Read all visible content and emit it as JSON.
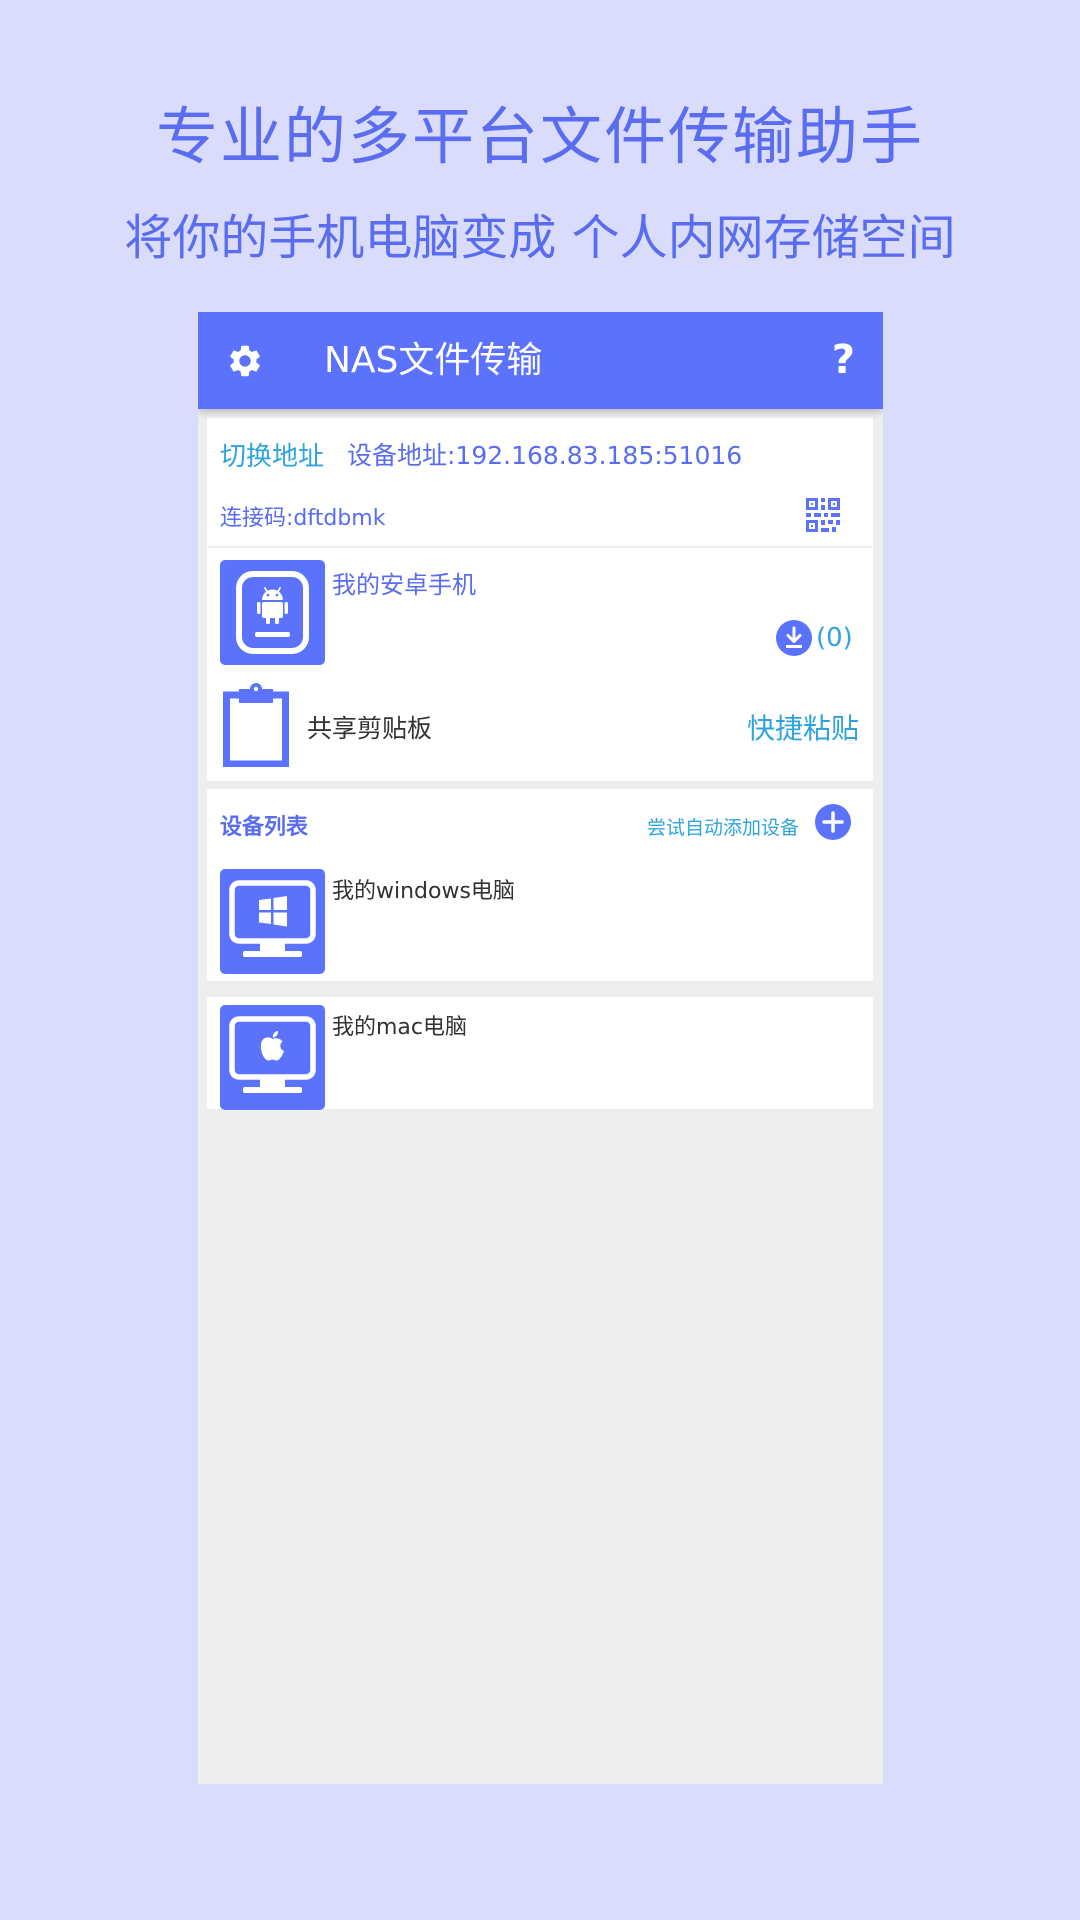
{
  "promo": {
    "title": "专业的多平台文件传输助手",
    "subtitle": "将你的手机电脑变成 个人内网存储空间"
  },
  "appbar": {
    "title": "NAS文件传输",
    "help": "?",
    "settings_icon": "gear-icon"
  },
  "address_card": {
    "switch_label": "切换地址",
    "device_address": "设备地址:192.168.83.185:51016",
    "connect_code": "连接码:dftdbmk",
    "qr_icon": "qr-code-icon"
  },
  "local_device": {
    "name": "我的安卓手机",
    "icon": "android-phone-icon",
    "download_count": "(0)"
  },
  "clipboard": {
    "label": "共享剪贴板",
    "paste_label": "快捷粘贴",
    "icon": "clipboard-icon"
  },
  "device_list": {
    "title": "设备列表",
    "auto_add_label": "尝试自动添加设备",
    "devices": [
      {
        "name": "我的windows电脑",
        "icon": "windows-monitor-icon"
      },
      {
        "name": "我的mac电脑",
        "icon": "mac-monitor-icon"
      }
    ]
  },
  "colors": {
    "page_background": "#d9dcfb",
    "primary": "#5b73fc",
    "accent_text": "#2fa4dc",
    "list_background": "#eeeeee"
  }
}
